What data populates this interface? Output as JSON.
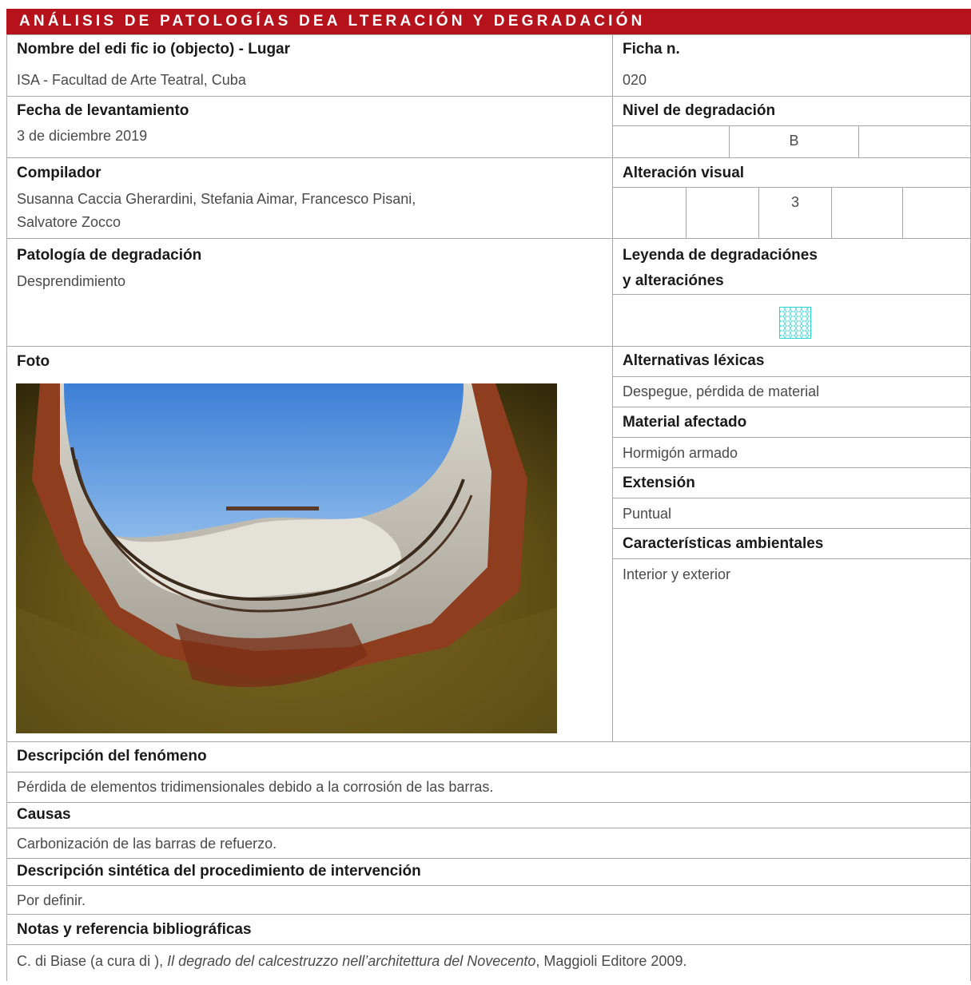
{
  "header": {
    "title": "ANÁLISIS DE PATOLOGÍAS DEA LTERACIÓN Y DEGRADACIÓN"
  },
  "building": {
    "label": "Nombre del edi fic io (objecto) - Lugar",
    "value": "ISA - Facultad de Arte Teatral, Cuba"
  },
  "sheet_no": {
    "label": "Ficha n.",
    "value": "020"
  },
  "survey_date": {
    "label": "Fecha de levantamiento",
    "value": "3 de diciembre 2019"
  },
  "degradation_level": {
    "label": "Nivel de degradación",
    "cells": [
      "",
      "B",
      ""
    ]
  },
  "compiler": {
    "label": "Compilador",
    "line1": "Susanna Caccia Gherardini, Stefania Aimar, Francesco Pisani,",
    "line2": "Salvatore Zocco"
  },
  "visual_alteration": {
    "label": "Alteración visual",
    "cells": [
      "",
      "",
      "3",
      "",
      ""
    ]
  },
  "pathology": {
    "label": "Patología de degradación",
    "value": "Desprendimiento"
  },
  "legend": {
    "label_line1": "Leyenda de degradaciónes",
    "label_line2": "y alteraciónes",
    "swatch_color": "#2ad4d4"
  },
  "photo": {
    "label": "Foto"
  },
  "lexical": {
    "label": "Alternativas léxicas",
    "value": "Despegue, pérdida de material"
  },
  "material": {
    "label": "Material afectado",
    "value": "Hormigón armado"
  },
  "extension": {
    "label": "Extensión",
    "value": "Puntual"
  },
  "environment": {
    "label": "Características ambientales",
    "value": "Interior y exterior"
  },
  "description": {
    "label": "Descripción del fenómeno",
    "value": "Pérdida de elementos tridimensionales debido a la corrosión de las barras."
  },
  "causes": {
    "label": "Causas",
    "value": "Carbonización de las barras de refuerzo."
  },
  "procedure": {
    "label": "Descripción sintética del procedimiento de intervención",
    "value": "Por definir."
  },
  "notes": {
    "label": "Notas y referencia bibliográficas",
    "prefix": "C. di Biase (a cura di ), ",
    "title_italic": "Il degrado del calcestruzzo nell’architettura del Novecento",
    "suffix": ", Maggioli Editore 2009."
  },
  "colors": {
    "banner": "#b5121b",
    "border": "#a8a8a8"
  }
}
